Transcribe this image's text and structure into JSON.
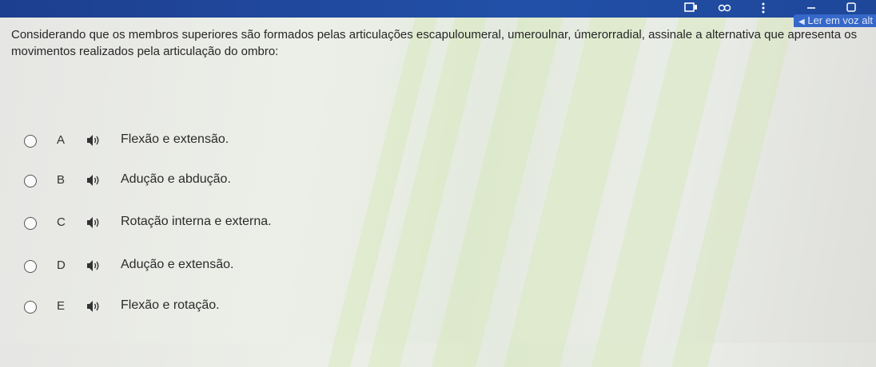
{
  "window": {
    "read_aloud_label": "Ler em voz alt"
  },
  "question": {
    "text": "Considerando que os membros superiores são formados pelas articulações escapuloumeral, umeroulnar, úmerorradial, assinale a alternativa que apresenta os movimentos realizados pela articulação do ombro:"
  },
  "options": [
    {
      "letter": "A",
      "text": "Flexão e extensão."
    },
    {
      "letter": "B",
      "text": "Adução e abdução."
    },
    {
      "letter": "C",
      "text": "Rotação interna e externa."
    },
    {
      "letter": "D",
      "text": "Adução e extensão."
    },
    {
      "letter": "E",
      "text": "Flexão e rotação."
    }
  ],
  "icons": {
    "option_audio": "speaker-icon",
    "window_controls": [
      "screenshot-icon",
      "extensions-icon",
      "menu-icon",
      "minimize-icon",
      "maximize-icon"
    ]
  }
}
